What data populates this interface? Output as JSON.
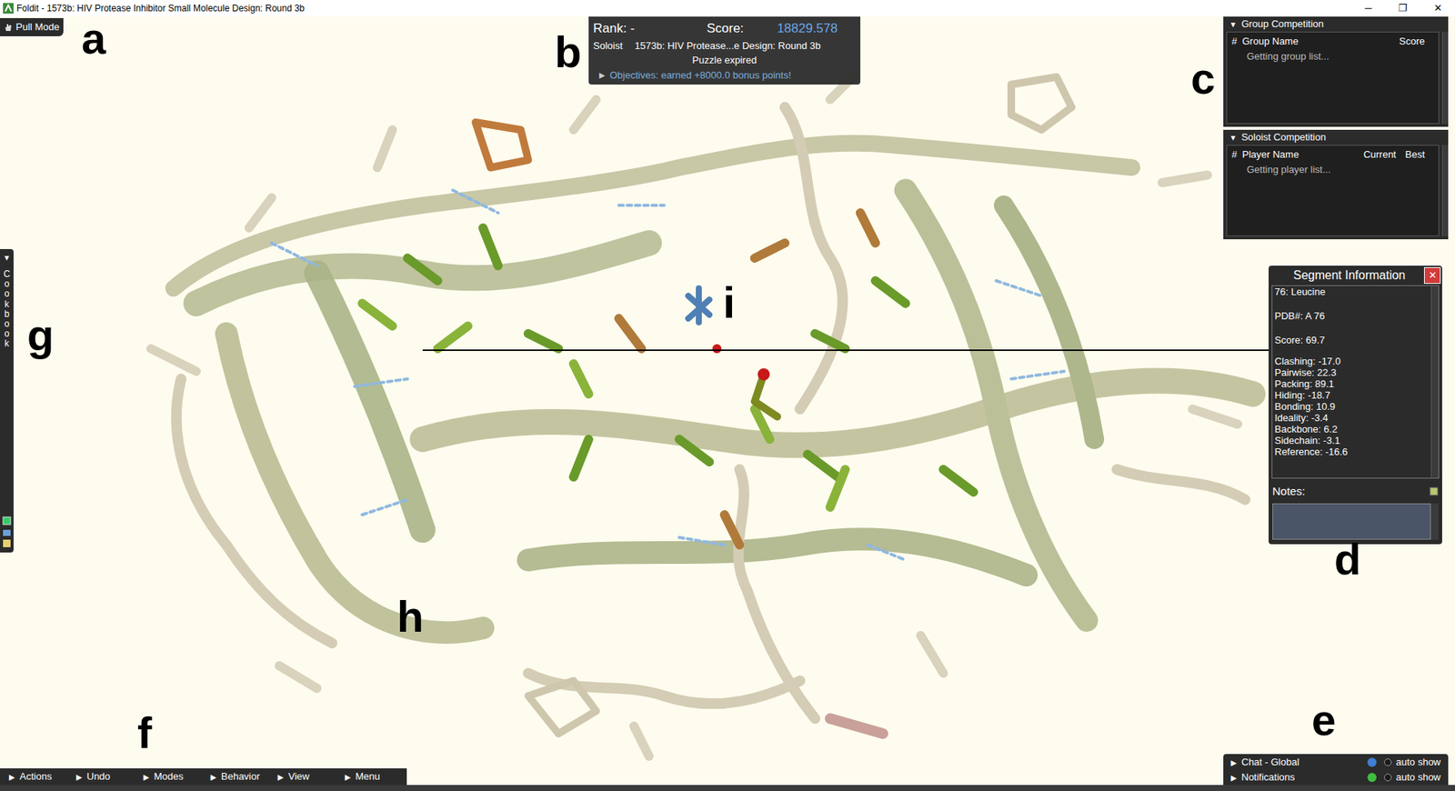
{
  "window": {
    "title": "Foldit - 1573b: HIV Protease Inhibitor Small Molecule Design: Round 3b",
    "controls": [
      "─",
      "❐",
      "✕"
    ]
  },
  "mode_button": {
    "label": "Pull Mode"
  },
  "score_panel": {
    "rank_label": "Rank: -",
    "score_label": "Score:",
    "score": "18829.578",
    "player_type": "Soloist",
    "puzzle": "1573b: HIV Protease...e Design: Round 3b",
    "status": "Puzzle expired",
    "objectives_arrow": "▶",
    "objectives": "Objectives: earned +8000.0 bonus points!",
    "objectives_expanded": false
  },
  "group_competition": {
    "arrow": "▼",
    "title": "Group Competition",
    "expanded": true,
    "columns": [
      "#",
      "Group Name",
      "Score"
    ],
    "message": "Getting group list..."
  },
  "soloist_competition": {
    "arrow": "▼",
    "title": "Soloist Competition",
    "expanded": true,
    "columns": [
      "#",
      "Player Name",
      "Current",
      "Best"
    ],
    "message": "Getting player list..."
  },
  "segment_info": {
    "title": "Segment Information",
    "close": "✕",
    "name": "76: Leucine",
    "pdb": "PDB#: A 76",
    "score": "Score: 69.7",
    "terms": [
      "Clashing: -17.0",
      "Pairwise: 22.3",
      "Packing: 89.1",
      "Hiding: -18.7",
      "Bonding: 10.9",
      "Ideality: -3.4",
      "Backbone: 6.2",
      "Sidechain: -3.1",
      "Reference: -16.6"
    ],
    "notes_label": "Notes:"
  },
  "cookbook": {
    "arrow": "▼",
    "label": "Cookbook"
  },
  "bottom_menu": [
    {
      "arrow": "▶",
      "label": "Actions"
    },
    {
      "arrow": "▶",
      "label": "Undo"
    },
    {
      "arrow": "▶",
      "label": "Modes"
    },
    {
      "arrow": "▶",
      "label": "Behavior"
    },
    {
      "arrow": "▶",
      "label": "View"
    },
    {
      "arrow": "▶",
      "label": "Menu"
    }
  ],
  "chat": [
    {
      "arrow": "▶",
      "label": "Chat - Global",
      "auto_show": "auto show",
      "checked": false,
      "color": "#3f7fd6"
    },
    {
      "arrow": "▶",
      "label": "Notifications",
      "auto_show": "auto show",
      "checked": false,
      "color": "#3fbf3f"
    }
  ],
  "annotations": [
    "a",
    "b",
    "c",
    "d",
    "e",
    "f",
    "g",
    "h",
    "i"
  ]
}
